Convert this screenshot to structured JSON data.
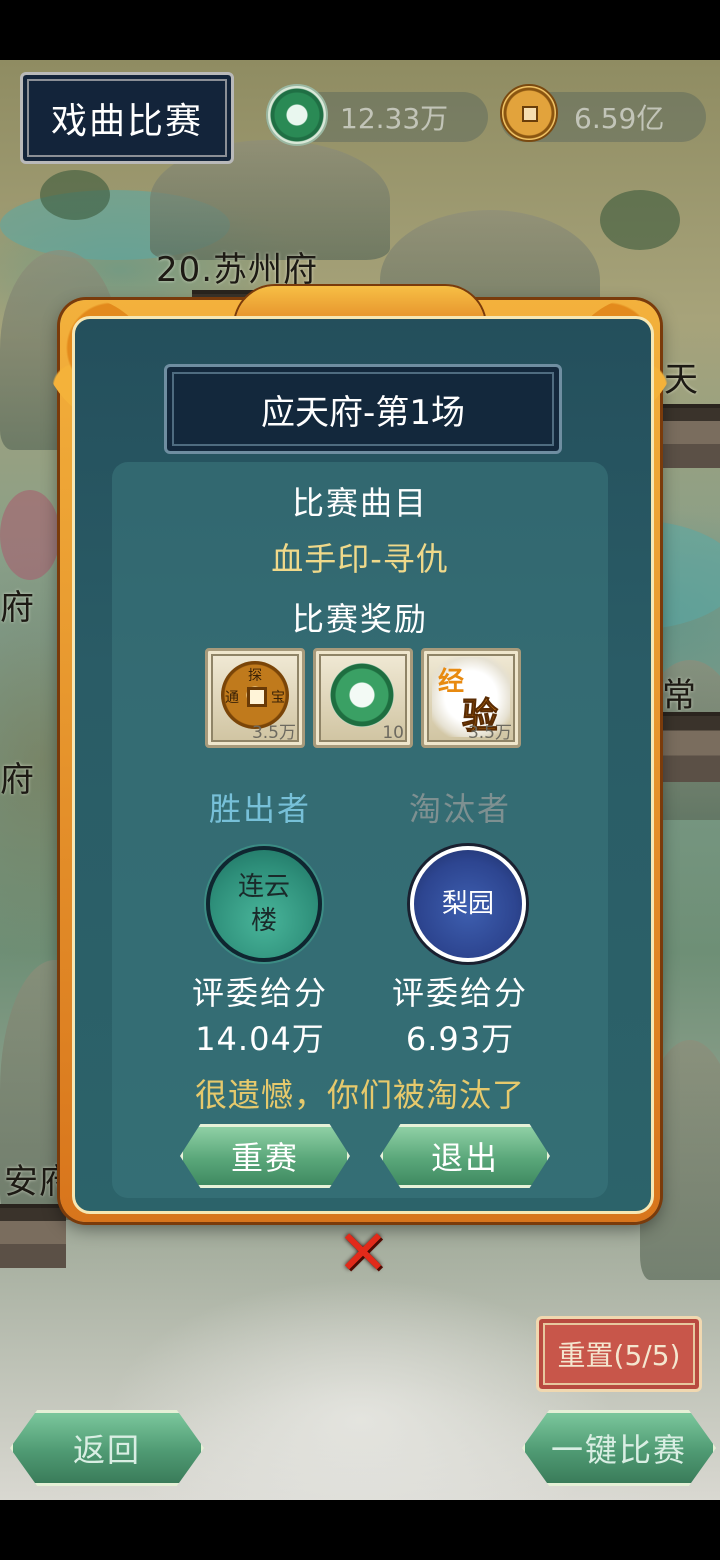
{
  "header": {
    "title": "戏曲比赛",
    "currency_jade": "12.33万",
    "currency_gold": "6.59亿"
  },
  "map_labels": {
    "suzhou": "20.苏州府",
    "right_top": "天府",
    "left_mid": "府",
    "changzhou": "常州",
    "left_lower": "府",
    "anqing": "安府"
  },
  "dialog": {
    "round_title": "应天府-第1场",
    "song_heading": "比赛曲目",
    "song_name": "血手印-寻仇",
    "reward_heading": "比赛奖励",
    "rewards": [
      {
        "icon": "copper-coin-icon",
        "qty": "3.5万",
        "coin_chars": [
          "探",
          "宝",
          "通"
        ]
      },
      {
        "icon": "jade-disc-icon",
        "qty": "10"
      },
      {
        "icon": "experience-icon",
        "qty": "3.5万",
        "chars": [
          "经",
          "验"
        ]
      }
    ],
    "winner_label": "胜出者",
    "loser_label": "淘汰者",
    "winner_team": "连云楼",
    "loser_team": "梨园",
    "score_label": "评委给分",
    "winner_score": "14.04万",
    "loser_score": "6.93万",
    "result_message": "很遗憾，你们被淘汰了",
    "replay_button": "重赛",
    "exit_button": "退出",
    "close_symbol": "✕"
  },
  "controls": {
    "reset_button": "重置(5/5)",
    "back_button": "返回",
    "auto_button": "一键比赛"
  },
  "colors": {
    "dialog_frame": "#f3b13c",
    "panel": "#2a5c66",
    "song_name": "#f0d98a",
    "winner_label": "#77c0d8",
    "result_message": "#e6c96c",
    "reset_button": "#c8564a"
  }
}
